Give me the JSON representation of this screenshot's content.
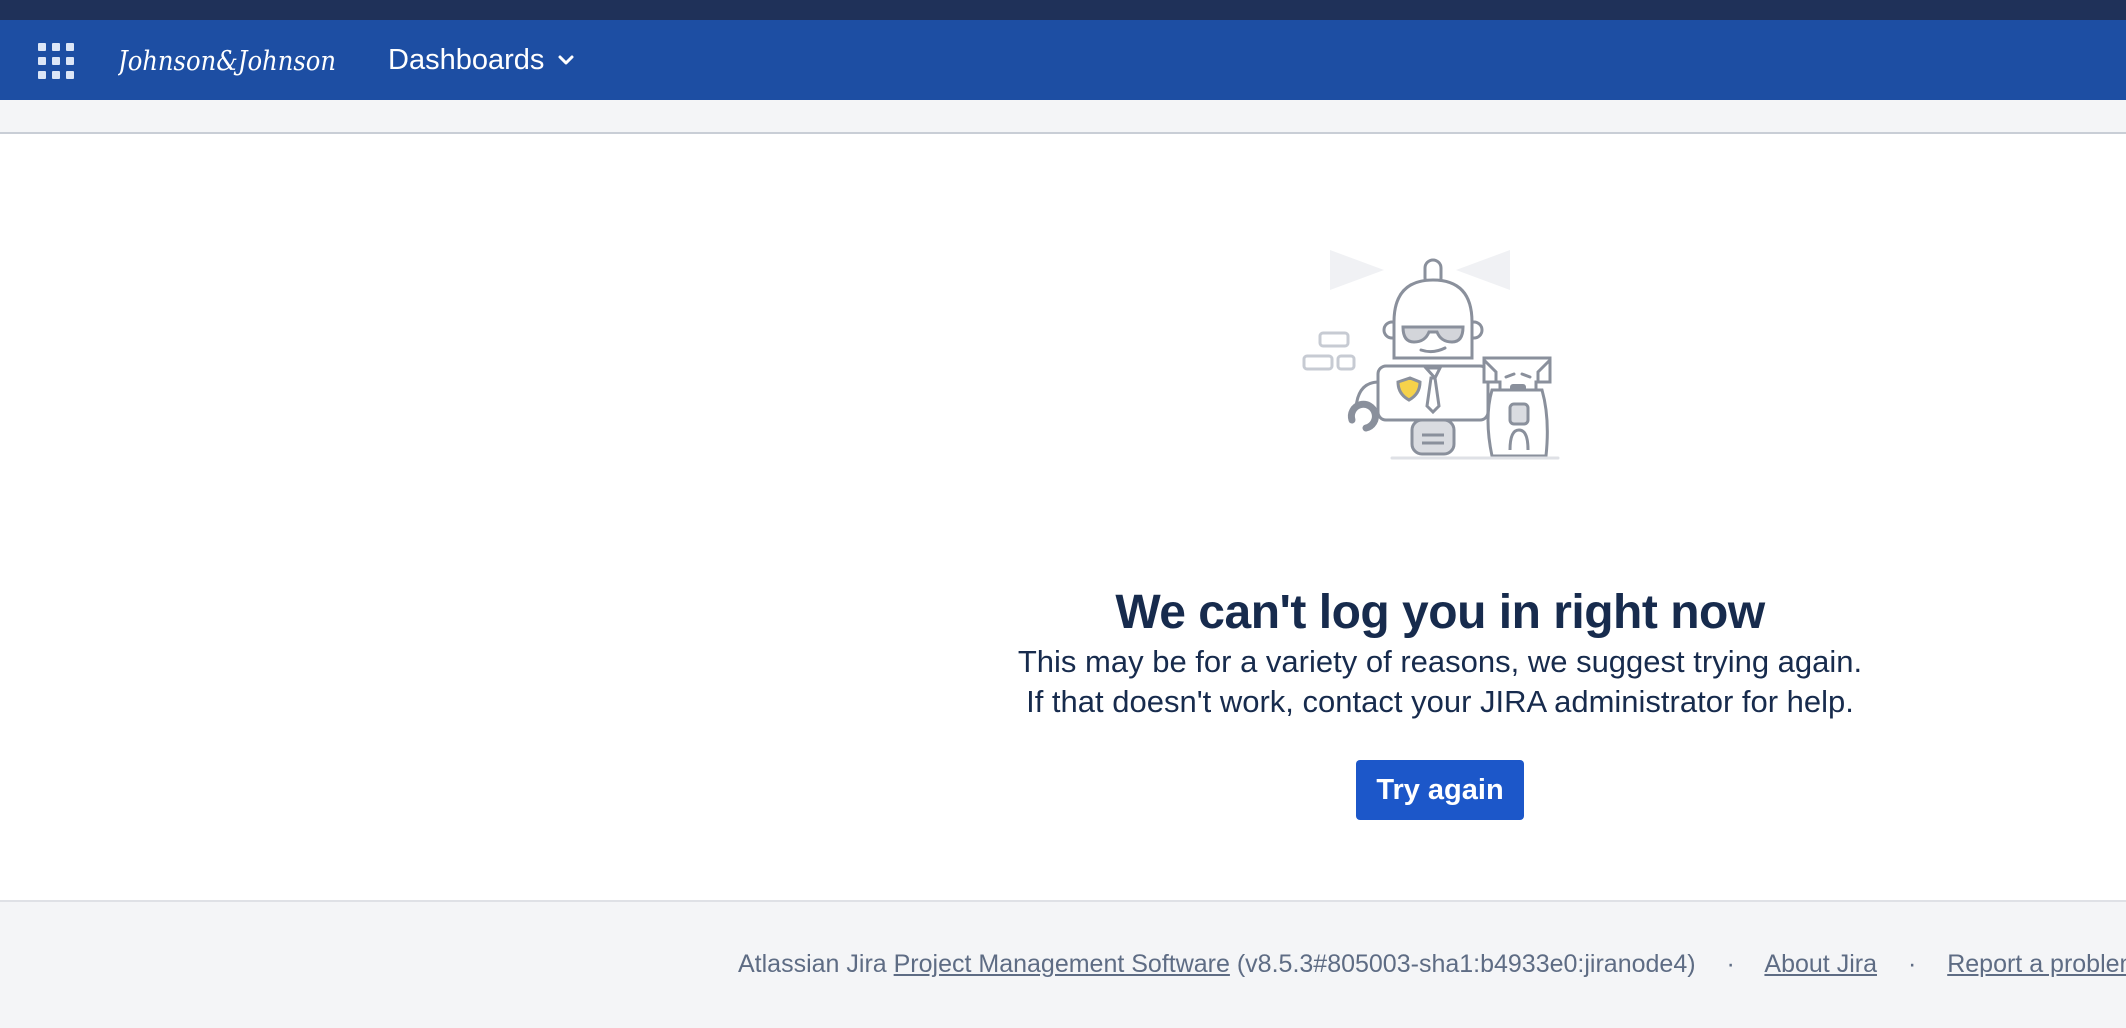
{
  "nav": {
    "logo_text": "Johnson&Johnson",
    "dashboards_label": "Dashboards",
    "app_switcher_icon": "app-grid-icon",
    "dropdown_icon": "chevron-down-icon"
  },
  "main": {
    "illustration": "robot-and-dog-illustration",
    "title": "We can't log you in right now",
    "message_line1": "This may be for a variety of reasons, we suggest trying again.",
    "message_line2": "If that doesn't work, contact your JIRA administrator for help.",
    "button_label": "Try again"
  },
  "footer": {
    "prefix": "Atlassian Jira",
    "pm_link": "Project Management Software",
    "version": "(v8.5.3#805003-sha1:b4933e0:jiranode4)",
    "separator": "·",
    "about_link": "About Jira",
    "report_link": "Report a problem"
  },
  "colors": {
    "nav_background": "#1d4ea3",
    "top_strip": "#1f3159",
    "button_primary": "#1c57c9",
    "heading_text": "#172b4d",
    "footer_background": "#f4f5f7"
  }
}
